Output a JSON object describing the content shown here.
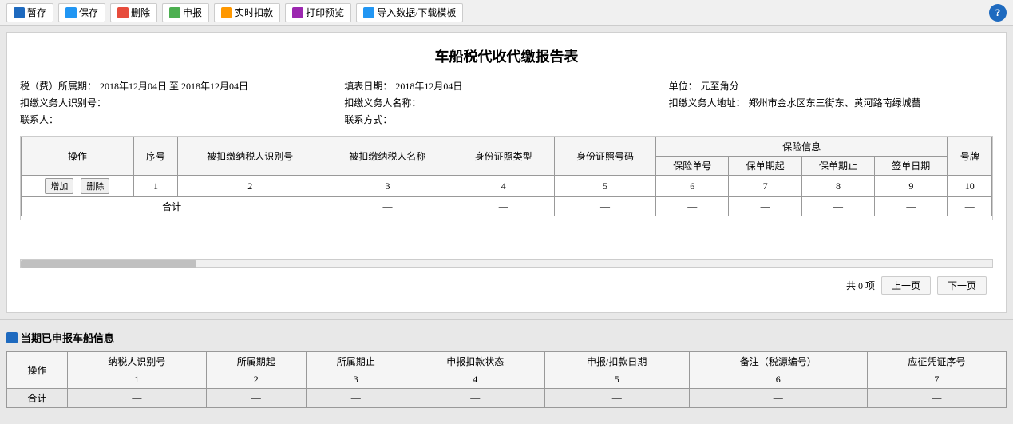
{
  "toolbar": {
    "buttons": [
      {
        "label": "暂存",
        "icon": "save-icon",
        "color": "#1e6abf"
      },
      {
        "label": "保存",
        "icon": "save2-icon",
        "color": "#2196f3"
      },
      {
        "label": "删除",
        "icon": "del-icon",
        "color": "#e74c3c"
      },
      {
        "label": "申报",
        "icon": "report-icon",
        "color": "#4caf50"
      },
      {
        "label": "实时扣款",
        "icon": "pay-icon",
        "color": "#ff9800"
      },
      {
        "label": "打印预览",
        "icon": "print-icon",
        "color": "#9c27b0"
      },
      {
        "label": "导入数据/下载模板",
        "icon": "import-icon",
        "color": "#2196f3"
      }
    ],
    "help_label": "?"
  },
  "report": {
    "title": "车船税代收代缴报告表",
    "meta": {
      "tax_period_label": "税（费）所属期：",
      "tax_period_value": "2018年12月04日 至 2018年12月04日",
      "fill_date_label": "填表日期：",
      "fill_date_value": "2018年12月04日",
      "unit_label": "单位：",
      "unit_value": "元至角分",
      "withhold_id_label": "扣缴义务人识别号：",
      "withhold_id_value": "",
      "withhold_name_label": "扣缴义务人名称：",
      "withhold_name_value": "",
      "withhold_addr_label": "扣缴义务人地址：",
      "withhold_addr_value": "郑州市金水区东三街东、黄河路南绿城薔",
      "contact_label": "联系人：",
      "contact_value": "",
      "contact_method_label": "联系方式：",
      "contact_method_value": ""
    },
    "table_headers": {
      "col1": "操作",
      "col2": "序号",
      "col3": "被扣缴纳税人识别号",
      "col4": "被扣缴纳税人名称",
      "col5": "身份证照类型",
      "col6": "身份证照号码",
      "insurance_group": "保险信息",
      "col7": "保险单号",
      "col8": "保单期起",
      "col9": "保单期止",
      "col10": "签单日期",
      "col11": "号牌"
    },
    "table_rows": [
      {
        "op_add": "增加",
        "op_del": "删除",
        "seq": "1",
        "col3": "2",
        "col4": "3",
        "col5": "4",
        "col6": "5",
        "col7": "6",
        "col8": "7",
        "col9": "8",
        "col10": "9",
        "col11": "10"
      }
    ],
    "summary_row": {
      "label": "合计",
      "col4": "—",
      "col5": "—",
      "col6": "—",
      "col7": "—",
      "col8": "—",
      "col9": "—",
      "col10": "—",
      "col11": "—"
    },
    "pagination": {
      "total": "共 0 项",
      "prev": "上一页",
      "next": "下一页"
    }
  },
  "section2": {
    "title": "当期已申报车船信息",
    "table_headers": {
      "col1": "操作",
      "col2": "纳税人识别号",
      "col3": "所属期起",
      "col4": "所属期止",
      "col5": "申报扣款状态",
      "col6": "申报/扣款日期",
      "col7": "备注（税源编号）",
      "col8": "应征凭证序号"
    },
    "col_numbers": {
      "col2": "1",
      "col3": "2",
      "col4": "3",
      "col5": "4",
      "col6": "5",
      "col7": "6",
      "col8": "7"
    },
    "summary_row": {
      "label": "合计",
      "col2": "—",
      "col3": "—",
      "col4": "—",
      "col5": "—",
      "col6": "—",
      "col7": "—",
      "col8": "—"
    }
  }
}
